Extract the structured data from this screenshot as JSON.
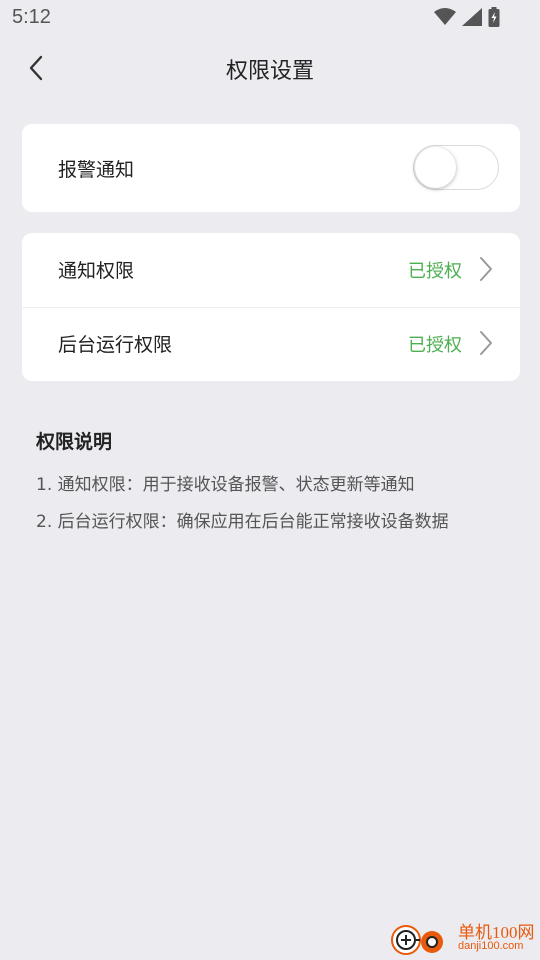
{
  "status_bar": {
    "time": "5:12",
    "icons": [
      "wifi-icon",
      "signal-icon",
      "battery-charging-icon"
    ]
  },
  "header": {
    "title": "权限设置",
    "back_icon": "chevron-left-icon"
  },
  "alarm_card": {
    "label": "报警通知",
    "toggle_on": false
  },
  "permissions": [
    {
      "label": "通知权限",
      "status": "已授权"
    },
    {
      "label": "后台运行权限",
      "status": "已授权"
    }
  ],
  "explanation": {
    "title": "权限说明",
    "items": [
      "1. 通知权限：用于接收设备报警、状态更新等通知",
      "2. 后台运行权限：确保应用在后台能正常接收设备数据"
    ]
  },
  "watermark": {
    "name": "单机100网",
    "domain": "danji100.com"
  },
  "colors": {
    "background": "#ebebf0",
    "granted": "#4caf50",
    "watermark": "#e85a0c"
  }
}
